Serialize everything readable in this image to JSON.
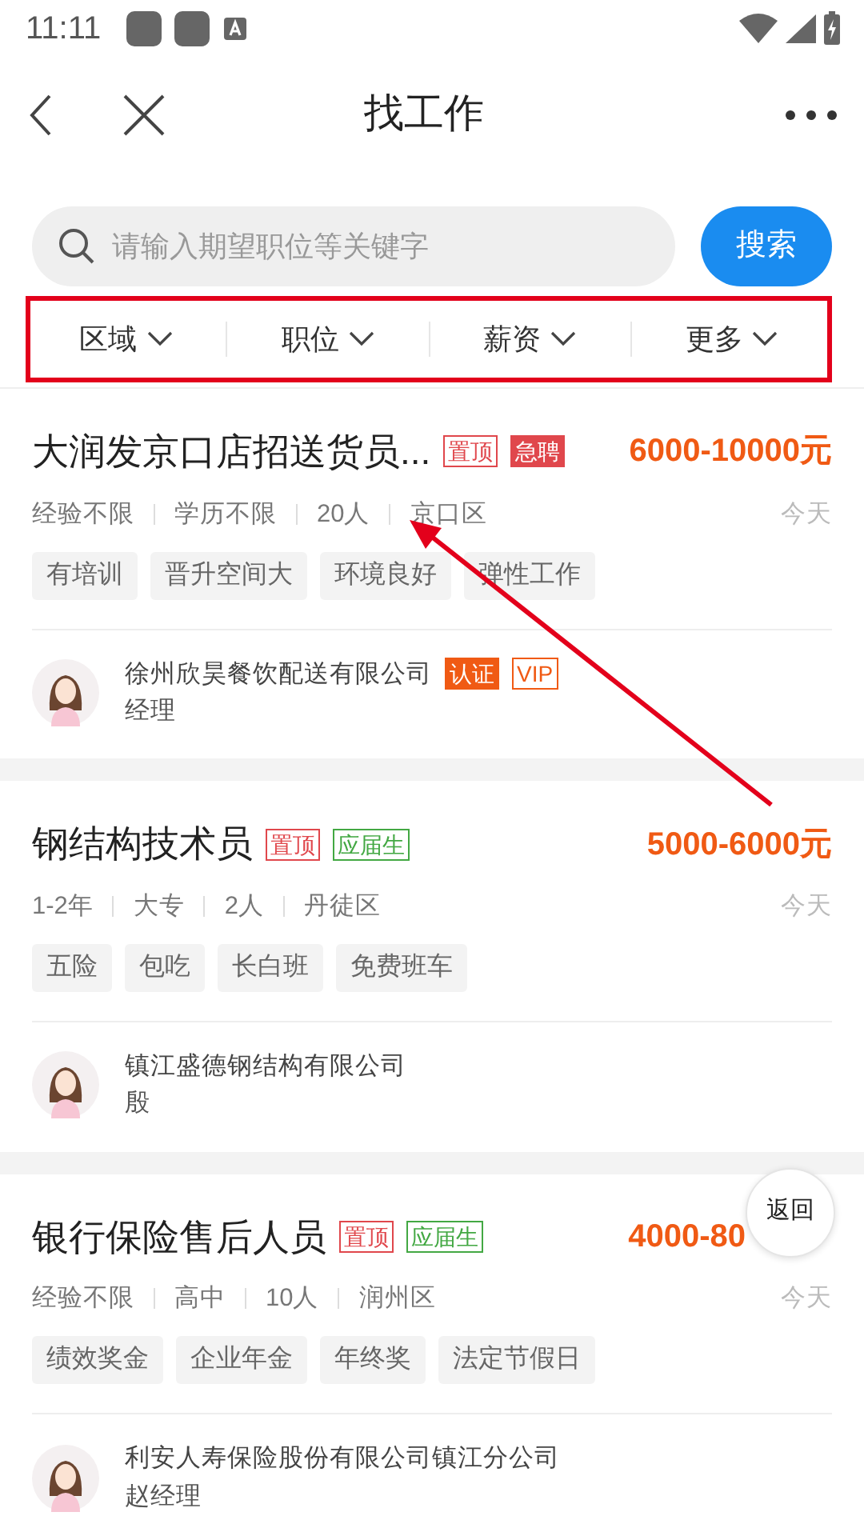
{
  "status_bar": {
    "time": "11:11"
  },
  "header": {
    "title": "找工作"
  },
  "search": {
    "placeholder": "请输入期望职位等关键字",
    "button": "搜索"
  },
  "filters": [
    {
      "label": "区域"
    },
    {
      "label": "职位"
    },
    {
      "label": "薪资"
    },
    {
      "label": "更多"
    }
  ],
  "jobs": [
    {
      "title": "大润发京口店招送货员...",
      "badges": [
        {
          "text": "置顶",
          "kind": "outline",
          "color": "#e0474c"
        },
        {
          "text": "急聘",
          "kind": "solid",
          "color": "#e0474c"
        }
      ],
      "salary": "6000-10000元",
      "meta": [
        "经验不限",
        "学历不限",
        "20人",
        "京口区"
      ],
      "posted": "今天",
      "tags": [
        "有培训",
        "晋升空间大",
        "环境良好",
        "弹性工作"
      ],
      "company": "徐州欣昊餐饮配送有限公司",
      "company_badges": [
        {
          "text": "认证",
          "kind": "solid",
          "color": "#f05a14"
        },
        {
          "text": "VIP",
          "kind": "outline",
          "color": "#f05a14"
        }
      ],
      "contact": "经理"
    },
    {
      "title": "钢结构技术员",
      "badges": [
        {
          "text": "置顶",
          "kind": "outline",
          "color": "#e0474c"
        },
        {
          "text": "应届生",
          "kind": "outline",
          "color": "#43a843"
        }
      ],
      "salary": "5000-6000元",
      "meta": [
        "1-2年",
        "大专",
        "2人",
        "丹徒区"
      ],
      "posted": "今天",
      "tags": [
        "五险",
        "包吃",
        "长白班",
        "免费班车"
      ],
      "company": "镇江盛德钢结构有限公司",
      "contact": "殷"
    },
    {
      "title": "银行保险售后人员",
      "badges": [
        {
          "text": "置顶",
          "kind": "outline",
          "color": "#e0474c"
        },
        {
          "text": "应届生",
          "kind": "outline",
          "color": "#43a843"
        }
      ],
      "salary": "4000-80",
      "meta": [
        "经验不限",
        "高中",
        "10人",
        "润州区"
      ],
      "posted": "今天",
      "tags": [
        "绩效奖金",
        "企业年金",
        "年终奖",
        "法定节假日"
      ],
      "company": "利安人寿保险股份有限公司镇江分公司",
      "contact": "赵经理"
    }
  ],
  "back_button": "返回"
}
